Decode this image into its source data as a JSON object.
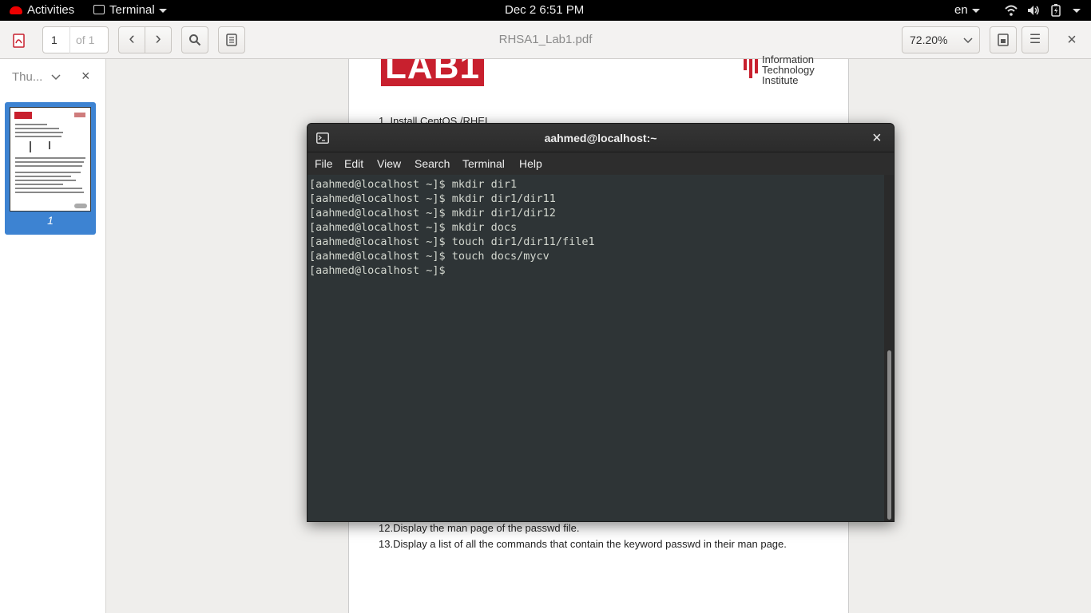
{
  "topbar": {
    "activities": "Activities",
    "app_menu": "Terminal",
    "clock": "Dec 2   6:51 PM",
    "language": "en"
  },
  "viewer": {
    "page_number": "1",
    "page_total": "of 1",
    "document_title": "RHSA1_Lab1.pdf",
    "zoom": "72.20%",
    "sidebar_mode": "Thu...",
    "thumbnail_page": "1"
  },
  "pdf_page": {
    "logo": "LAB1",
    "institute_lines": [
      "Information",
      "Technology",
      "Institute"
    ],
    "line_1": "1.  Install CentOS /RHEL",
    "line_12": "12.Display the man page of the passwd file.",
    "line_13": "13.Display a list of all the commands that contain the keyword passwd in their man page."
  },
  "terminal": {
    "title": "aahmed@localhost:~",
    "menu": [
      "File",
      "Edit",
      "View",
      "Search",
      "Terminal",
      "Help"
    ],
    "lines": [
      "[aahmed@localhost ~]$ mkdir dir1",
      "[aahmed@localhost ~]$ mkdir dir1/dir11",
      "[aahmed@localhost ~]$ mkdir dir1/dir12",
      "[aahmed@localhost ~]$ mkdir docs",
      "[aahmed@localhost ~]$ touch dir1/dir11/file1",
      "[aahmed@localhost ~]$ touch docs/mycv",
      "[aahmed@localhost ~]$ "
    ]
  },
  "icons": {
    "close": "×",
    "prev": "‹",
    "next": "›",
    "menu": "☰"
  }
}
